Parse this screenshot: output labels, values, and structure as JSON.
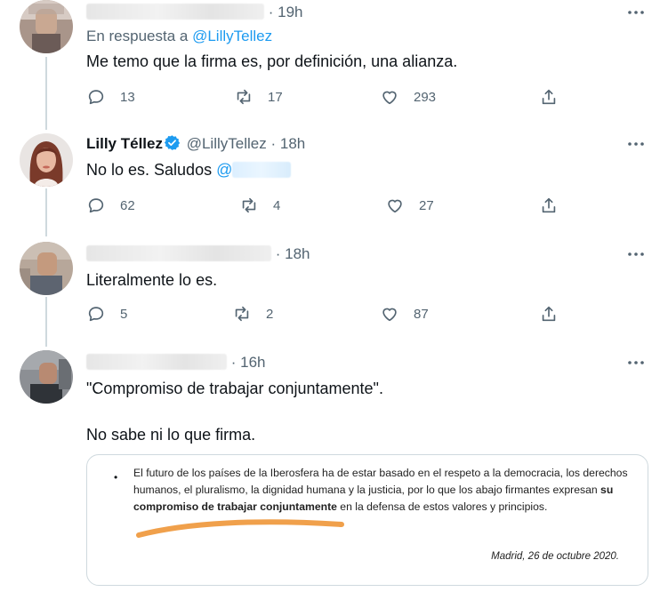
{
  "tweets": [
    {
      "time": "19h",
      "reply_prefix": "En respuesta a",
      "reply_handle": "@LillyTellez",
      "text": "Me temo que la firma es, por definición, una alianza.",
      "replies": "13",
      "retweets": "17",
      "likes": "293"
    },
    {
      "name": "Lilly Téllez",
      "handle": "@LillyTellez",
      "time": "18h",
      "text": "No lo es. Saludos ",
      "mention": "@",
      "replies": "62",
      "retweets": "4",
      "likes": "27"
    },
    {
      "time": "18h",
      "text": "Literalmente lo es.",
      "replies": "5",
      "retweets": "2",
      "likes": "87"
    },
    {
      "time": "16h",
      "text_line1": "\"Compromiso de trabajar conjuntamente\".",
      "text_line2": "No sabe ni lo que firma."
    }
  ],
  "separator": "·",
  "image": {
    "bullet": "•",
    "text_before": "El futuro de los países de la Iberosfera ha de estar basado en el respeto a la democracia, los derechos humanos, el pluralismo, la dignidad humana y la justicia, por lo que los abajo firmantes expresan ",
    "text_bold": "su compromiso de trabajar conjuntamente",
    "text_after": " en la defensa de estos valores y principios.",
    "date": "Madrid, 26 de octubre 2020."
  },
  "icons": {
    "reply": "reply-icon",
    "retweet": "retweet-icon",
    "like": "heart-icon",
    "share": "share-icon",
    "more": "more-dots-icon",
    "verified": "verified-badge-icon"
  },
  "colors": {
    "text": "#0f1419",
    "secondary": "#536471",
    "link": "#1d9bf0",
    "thread_line": "#cfd9de",
    "highlight_stroke": "#f0a04b"
  }
}
